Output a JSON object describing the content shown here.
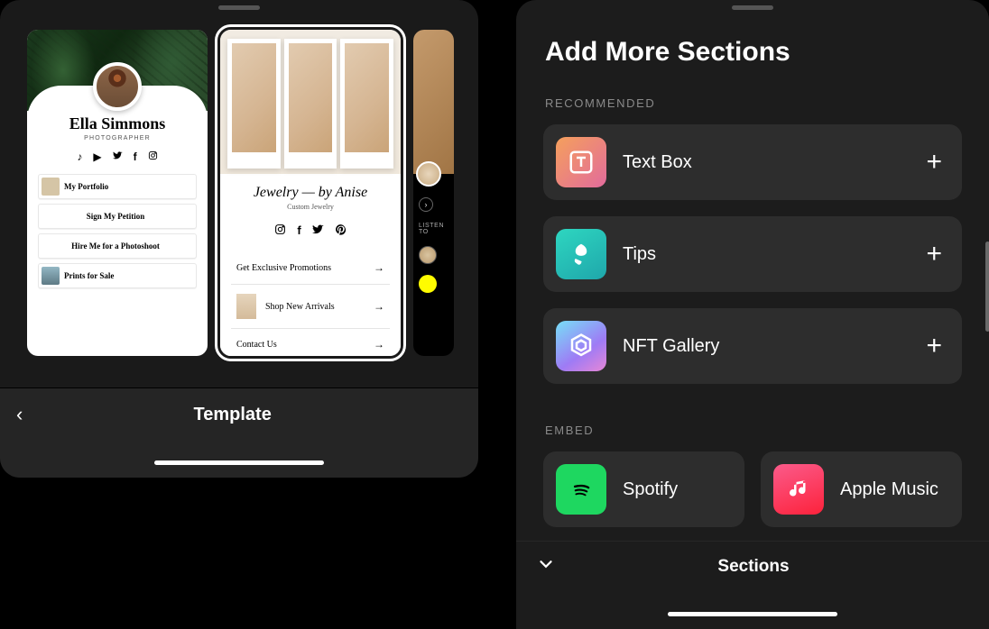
{
  "left": {
    "title": "Template",
    "cards": {
      "ella": {
        "name": "Ella Simmons",
        "subtitle": "PHOTOGRAPHER",
        "links": {
          "portfolio": "My Portfolio",
          "petition": "Sign My Petition",
          "hire": "Hire Me for a Photoshoot",
          "prints": "Prints for Sale"
        },
        "socials": [
          "tiktok",
          "youtube",
          "twitter",
          "facebook",
          "instagram"
        ]
      },
      "jewelry": {
        "title": "Jewelry — by Anise",
        "subtitle": "Custom Jewelry",
        "links": {
          "promo": "Get Exclusive Promotions",
          "shop": "Shop New Arrivals",
          "contact": "Contact Us"
        },
        "socials": [
          "instagram",
          "facebook",
          "twitter",
          "pinterest"
        ]
      },
      "listen": {
        "section_label": "LISTEN TO"
      }
    }
  },
  "right": {
    "title": "Add More Sections",
    "labels": {
      "recommended": "RECOMMENDED",
      "embed": "EMBED"
    },
    "recommended": {
      "textbox": "Text Box",
      "tips": "Tips",
      "nft": "NFT Gallery"
    },
    "embed": {
      "spotify": "Spotify",
      "apple": "Apple Music"
    },
    "bottom_title": "Sections"
  }
}
